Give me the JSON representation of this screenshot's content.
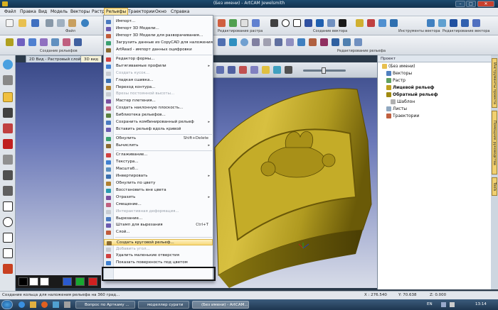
{
  "window": {
    "title": "(Без имени) - ArtCAM Jewelsmith",
    "min": "–",
    "max": "□",
    "close": "✕"
  },
  "menubar": {
    "items": [
      "Файл",
      "Правка",
      "Вид",
      "Модель",
      "Векторы",
      "Растр",
      "Рельефы",
      "Траектории",
      "Окно",
      "Справка"
    ]
  },
  "toolbars": {
    "row1_labels": [
      "Файл",
      "Редактирование растра",
      "Создание вектора",
      "Инструменты вектора",
      "Редактирование вектора"
    ],
    "row2_labels": [
      "Создание рельефов",
      "Редактирование рельефа"
    ]
  },
  "view": {
    "tabs": [
      "2D Вид - Растровый слой",
      "3D вид"
    ]
  },
  "relief_menu": {
    "items": [
      {
        "label": "Импорт...",
        "icon": "import-icon"
      },
      {
        "label": "Импорт 3D Модели...",
        "icon": "import-3d-icon"
      },
      {
        "label": "Импорт 3D Модели для разворачивания...",
        "icon": "import-3d-unwrap-icon"
      },
      {
        "label": "Загрузить данные из CopyCAD для наложения...",
        "icon": "copycad-icon"
      },
      {
        "label": "ArtRead - импорт данных оцифровки",
        "icon": "artread-icon"
      },
      {
        "sep": true
      },
      {
        "label": "Редактор формы...",
        "icon": "shape-editor-icon"
      },
      {
        "label": "Вытягиваемые профили",
        "icon": "extrude-icon",
        "arrow": "▸"
      },
      {
        "label": "Создать кусок...",
        "icon": "piece-icon",
        "disabled": true
      },
      {
        "label": "Гладкая сшивка...",
        "icon": "smooth-icon"
      },
      {
        "label": "Переход контура...",
        "icon": "contour-icon"
      },
      {
        "label": "Врезы постоянной высоты...",
        "icon": "const-height-icon",
        "disabled": true
      },
      {
        "label": "Мастер плетения...",
        "icon": "weave-icon"
      },
      {
        "label": "Создать наклонную плоскость...",
        "icon": "plane-icon"
      },
      {
        "label": "Библиотека рельефов...",
        "icon": "library-icon"
      },
      {
        "label": "Сохранить комбинированный рельеф",
        "icon": "save-relief-icon",
        "arrow": "▸"
      },
      {
        "label": "Вставить рельеф вдоль кривой",
        "icon": "curve-icon"
      },
      {
        "sep": true
      },
      {
        "label": "Обнулить",
        "icon": "reset-icon",
        "shortcut": "Shift+Delete"
      },
      {
        "label": "Вычислить",
        "icon": "calc-icon",
        "arrow": "▸"
      },
      {
        "sep": true
      },
      {
        "label": "Сглаживание...",
        "icon": "smoothing-icon"
      },
      {
        "label": "Текстура...",
        "icon": "texture-icon"
      },
      {
        "label": "Масштаб...",
        "icon": "scale-icon"
      },
      {
        "label": "Инвертировать",
        "icon": "invert-icon",
        "arrow": "▸"
      },
      {
        "label": "Обнулить по цвету",
        "icon": "reset-color-icon"
      },
      {
        "label": "Восстановить вне цвета",
        "icon": "restore-color-icon"
      },
      {
        "label": "Отразить",
        "icon": "mirror-icon",
        "arrow": "▸"
      },
      {
        "label": "Смещение...",
        "icon": "offset-icon"
      },
      {
        "label": "Интерактивная деформация...",
        "icon": "deform-icon",
        "disabled": true
      },
      {
        "label": "Вырезание...",
        "icon": "cutout-icon"
      },
      {
        "label": "Штамп для вырезания",
        "icon": "stamp-icon",
        "shortcut": "Ctrl+T"
      },
      {
        "label": "Слой...",
        "icon": "layer-icon"
      },
      {
        "sep": true
      },
      {
        "label": "Создать круговой рельеф...",
        "icon": "round-relief-icon",
        "highlighted": true
      },
      {
        "label": "Добавить угол...",
        "icon": "angle-icon",
        "disabled": true
      },
      {
        "label": "Удалить маленькие отверстия",
        "icon": "holes-icon"
      },
      {
        "label": "Показать поверхность под цветом",
        "icon": "surface-icon"
      }
    ]
  },
  "project": {
    "header": "Проект",
    "root": "(Без имени)",
    "items": [
      {
        "label": "Векторы",
        "bold": false
      },
      {
        "label": "Растр",
        "bold": false
      },
      {
        "label": "Лицевой рельеф",
        "bold": true
      },
      {
        "label": "Обратный рельеф",
        "bold": true
      },
      {
        "label": "Шаблон",
        "bold": false
      },
      {
        "label": "Листы",
        "bold": false
      },
      {
        "label": "Траектории",
        "bold": false
      }
    ],
    "side_tabs": [
      "Инструменты проекта",
      "Помощник руководства",
      "Tools"
    ]
  },
  "status": {
    "hint": "Создание кольца для наложения рельефа на 360 град...",
    "x": "X : 276.540",
    "y": "Y: 70.638",
    "z": "Z: 0.000"
  },
  "taskbar": {
    "tasks": [
      {
        "label": "Вопрос по Арткаму ..."
      },
      {
        "label": "моделлер сурати"
      },
      {
        "label": "(Без имени) - ArtCAM..."
      }
    ],
    "lang": "EN",
    "time": "13:14"
  },
  "colors": {
    "palette": [
      "#000000",
      "#ffffff",
      "#ffffff",
      "#2a5ad0",
      "#18a830",
      "#d02020"
    ],
    "relief_gold": "#b8a020",
    "menu_highlight": "#f8d97a"
  }
}
